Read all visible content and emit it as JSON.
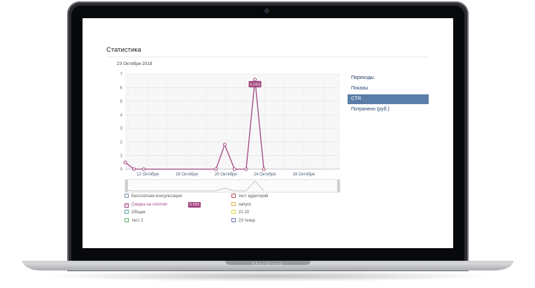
{
  "device": {
    "brand_label": "MacBook"
  },
  "page": {
    "title": "Статистика",
    "date_label": "23 Октября 2018"
  },
  "metrics_menu": {
    "items": [
      {
        "label": "Переходы",
        "active": false
      },
      {
        "label": "Показы",
        "active": false
      },
      {
        "label": "CTR",
        "active": true
      },
      {
        "label": "Потрачено (руб.)",
        "active": false
      }
    ]
  },
  "chart_data": {
    "type": "line",
    "title": "",
    "xlabel": "",
    "ylabel": "",
    "ylim": [
      0,
      7
    ],
    "y_ticks": [
      "0",
      "1",
      "2",
      "3",
      "4",
      "5",
      "6",
      "7"
    ],
    "x_tick_labels": [
      "12 Октября",
      "16 Октября",
      "20 Октября",
      "24 Октября",
      "28 Октября"
    ],
    "x_tick_days": [
      12,
      16,
      20,
      24,
      28
    ],
    "x_range_days": [
      9.7,
      31.7
    ],
    "grid": true,
    "series": [
      {
        "name": "Скидка на логотип",
        "color": "#a2457e",
        "x": [
          9.7,
          10.6,
          11.6,
          19.0,
          19.9,
          20.9,
          22.1,
          23.0,
          23.9
        ],
        "values": [
          0.5,
          0.0,
          0.0,
          0.0,
          1.8,
          0.0,
          0.0,
          6.593,
          0.0
        ]
      }
    ],
    "annotation": {
      "label": "6.593",
      "x": 23.0,
      "y": 6.593
    }
  },
  "legend": {
    "items": [
      {
        "label": "Бесплатная консультация",
        "color": "#7a8fb0",
        "checked": false
      },
      {
        "label": "тест аудиторий",
        "color": "#b65050",
        "checked": false
      },
      {
        "label": "Скидка на логотип",
        "color": "#a2457e",
        "checked": true,
        "value_tag": "6.593"
      },
      {
        "label": "запуск",
        "color": "#e0b64c",
        "checked": false
      },
      {
        "label": "Общая",
        "color": "#5aa7a2",
        "checked": false
      },
      {
        "label": "22.10",
        "color": "#d6d64a",
        "checked": false
      },
      {
        "label": "тест 2",
        "color": "#65b067",
        "checked": false
      },
      {
        "label": "23 тизер",
        "color": "#6b72b8",
        "checked": false
      }
    ]
  }
}
